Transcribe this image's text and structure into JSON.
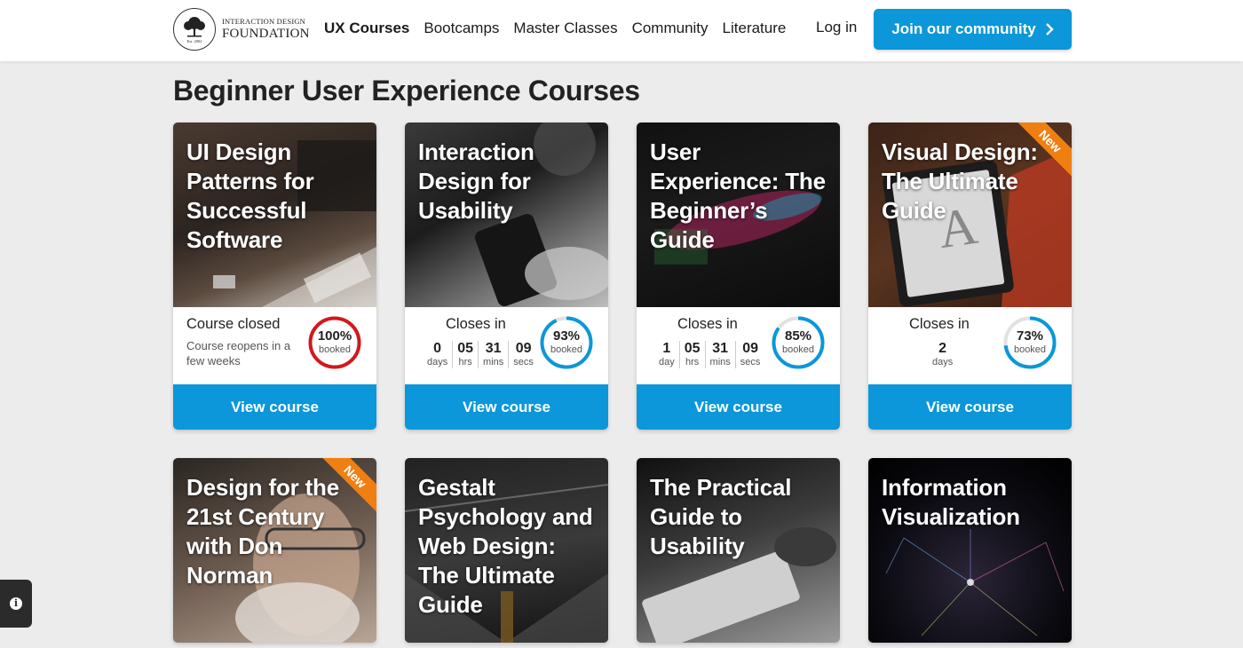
{
  "header": {
    "logo_line1": "INTERACTION DESIGN",
    "logo_line2": "FOUNDATION",
    "logo_est": "Est. 2002",
    "nav": [
      "UX Courses",
      "Bootcamps",
      "Master Classes",
      "Community",
      "Literature"
    ],
    "login": "Log in",
    "join": "Join our community"
  },
  "page_title": "Beginner User Experience Courses",
  "cards": [
    {
      "title": "UI Design Patterns for Successful Software",
      "status": "Course closed",
      "status_sub": "Course reopens in a few weeks",
      "percent": "100%",
      "percent_value": 100,
      "booked": "booked",
      "button": "View course"
    },
    {
      "title": "Interaction Design for Usability",
      "status": "Closes in",
      "countdown": [
        {
          "value": "0",
          "label": "days"
        },
        {
          "value": "05",
          "label": "hrs"
        },
        {
          "value": "31",
          "label": "mins"
        },
        {
          "value": "09",
          "label": "secs"
        }
      ],
      "percent": "93%",
      "percent_value": 93,
      "booked": "booked",
      "button": "View course"
    },
    {
      "title": "User Experience: The Beginner’s Guide",
      "status": "Closes in",
      "countdown": [
        {
          "value": "1",
          "label": "day"
        },
        {
          "value": "05",
          "label": "hrs"
        },
        {
          "value": "31",
          "label": "mins"
        },
        {
          "value": "09",
          "label": "secs"
        }
      ],
      "percent": "85%",
      "percent_value": 85,
      "booked": "booked",
      "button": "View course"
    },
    {
      "title": "Visual Design: The Ultimate Guide",
      "ribbon": "New",
      "status": "Closes in",
      "countdown": [
        {
          "value": "2",
          "label": "days"
        }
      ],
      "percent": "73%",
      "percent_value": 73,
      "booked": "booked",
      "button": "View course"
    },
    {
      "title": "Design for the 21st Century with Don Norman",
      "ribbon": "New"
    },
    {
      "title": "Gestalt Psychology and Web Design: The Ultimate Guide"
    },
    {
      "title": "The Practical Guide to Usability"
    },
    {
      "title": "Information Visualization"
    }
  ],
  "colors": {
    "brand_blue": "#0b97d9",
    "ring_closed": "#d0191d",
    "ribbon": "#f07f12"
  },
  "icons": [
    "chevron-right-icon",
    "info-icon",
    "tree-logo-icon"
  ]
}
